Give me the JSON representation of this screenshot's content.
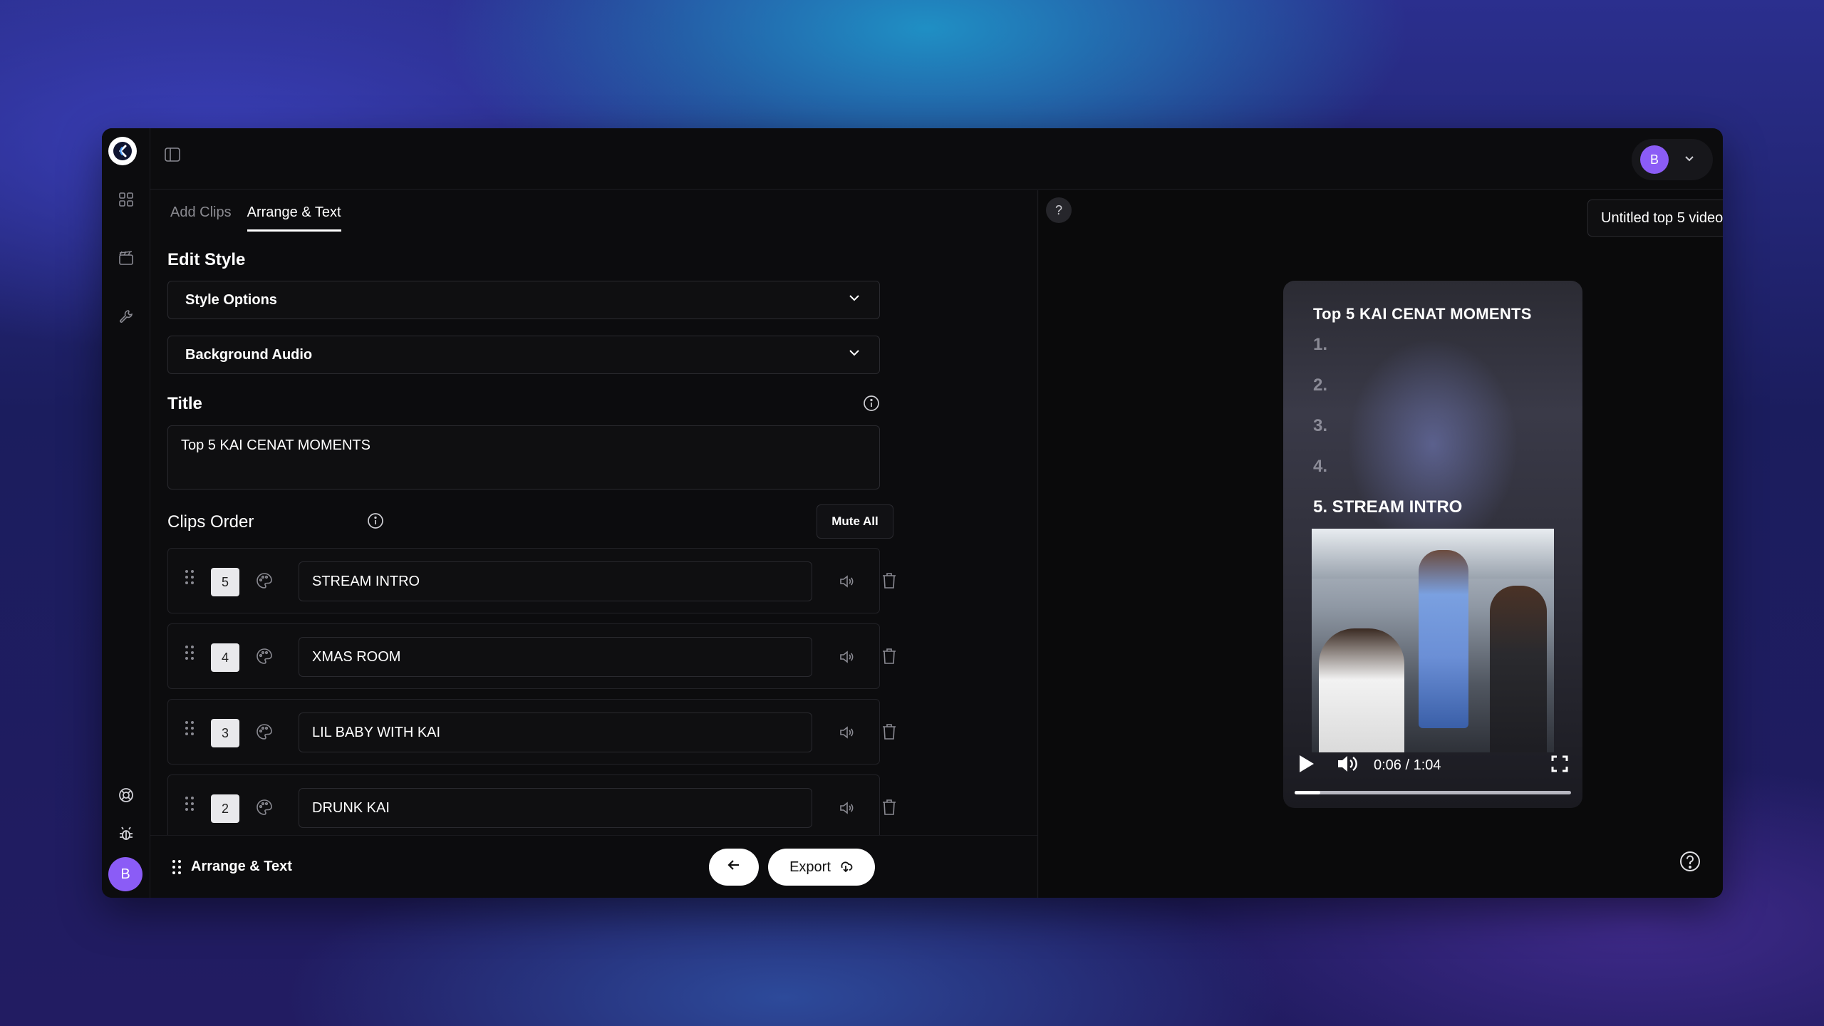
{
  "tabs": [
    {
      "label": "Add Clips"
    },
    {
      "label": "Arrange & Text"
    }
  ],
  "edit_style": {
    "heading": "Edit Style",
    "style_options": "Style Options",
    "background_audio": "Background Audio"
  },
  "title_section": {
    "heading": "Title",
    "value": "Top 5 KAI CENAT MOMENTS"
  },
  "clips_order": {
    "heading": "Clips Order",
    "mute_all": "Mute All",
    "clips": [
      {
        "number": "5",
        "name": "STREAM INTRO"
      },
      {
        "number": "4",
        "name": "XMAS ROOM"
      },
      {
        "number": "3",
        "name": "LIL BABY WITH KAI"
      },
      {
        "number": "2",
        "name": "DRUNK KAI"
      }
    ]
  },
  "footer": {
    "label": "Arrange & Text",
    "export": "Export"
  },
  "topbar": {
    "avatar_initial": "B"
  },
  "rail": {
    "avatar_initial": "B"
  },
  "preview": {
    "help": "?",
    "video_title": "Untitled top 5 video",
    "overlay_title": "Top 5 KAI CENAT MOMENTS",
    "ranks": [
      "1.",
      "2.",
      "3.",
      "4.",
      "5. STREAM INTRO"
    ],
    "time": "0:06 / 1:04",
    "progress_fraction": 0.094
  },
  "colors": {
    "accent_avatar": "#8b5cf6",
    "window_bg": "#0c0c0e"
  }
}
